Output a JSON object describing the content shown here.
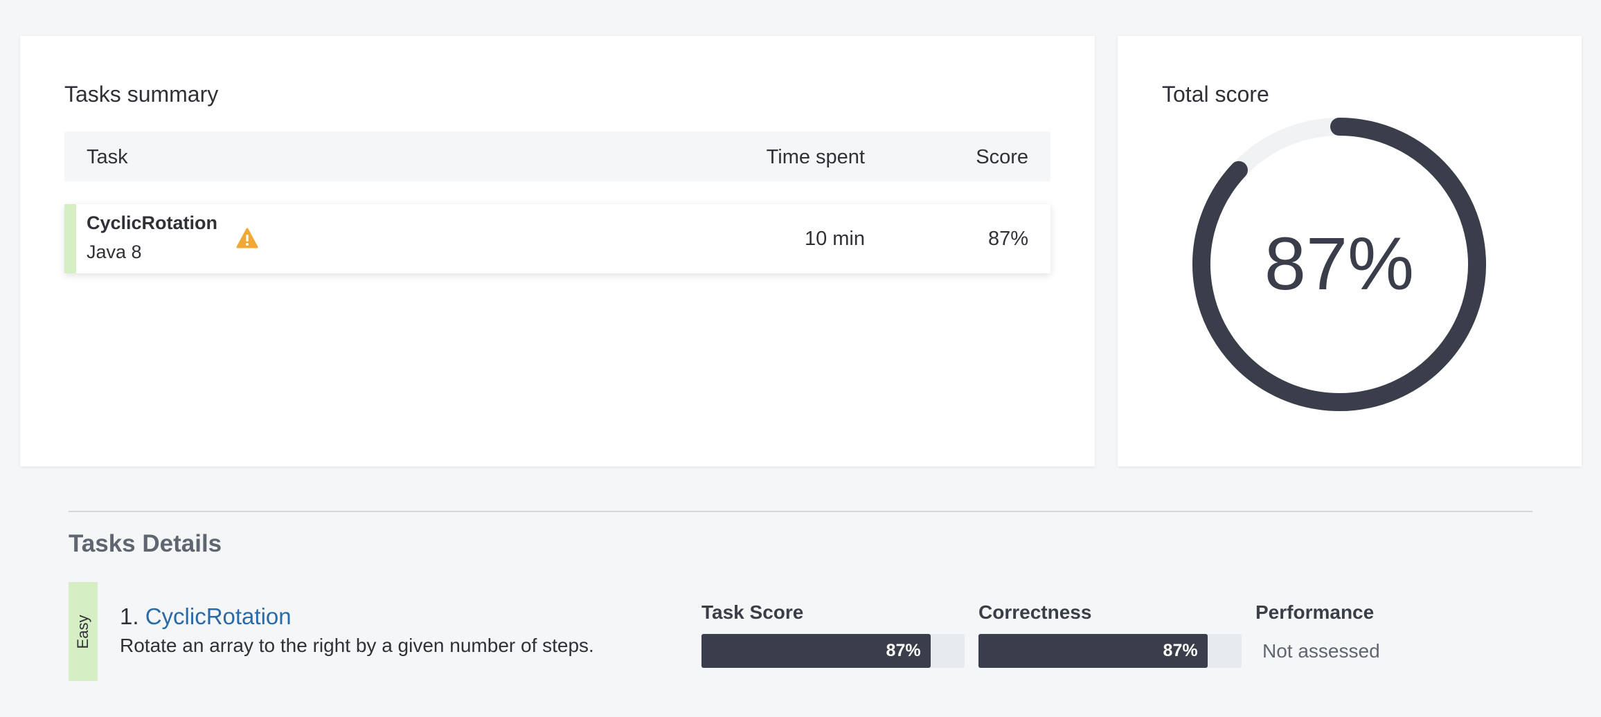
{
  "summary": {
    "title": "Tasks summary",
    "columns": {
      "task": "Task",
      "time": "Time spent",
      "score": "Score"
    },
    "row": {
      "name": "CyclicRotation",
      "language": "Java 8",
      "time": "10 min",
      "score": "87%",
      "warning_icon": "warning-triangle-icon"
    }
  },
  "total": {
    "title": "Total score",
    "value_text": "87%",
    "fraction": 0.87,
    "colors": {
      "ring": "#3a3d4a",
      "track": "#f1f2f4"
    }
  },
  "details": {
    "title": "Tasks Details",
    "task": {
      "difficulty": "Easy",
      "number": "1.",
      "name": "CyclicRotation",
      "description": "Rotate an array to the right by a given number of steps."
    },
    "metrics": {
      "task_score": {
        "label": "Task Score",
        "text": "87%",
        "fraction": 0.87
      },
      "correctness": {
        "label": "Correctness",
        "text": "87%",
        "fraction": 0.87
      },
      "performance": {
        "label": "Performance",
        "value": "Not assessed"
      }
    }
  },
  "colors": {
    "accent_green": "#d6eec4",
    "link_blue": "#2a6aa6",
    "warning": "#f0a733",
    "bar_dark": "#3a3d4a"
  }
}
